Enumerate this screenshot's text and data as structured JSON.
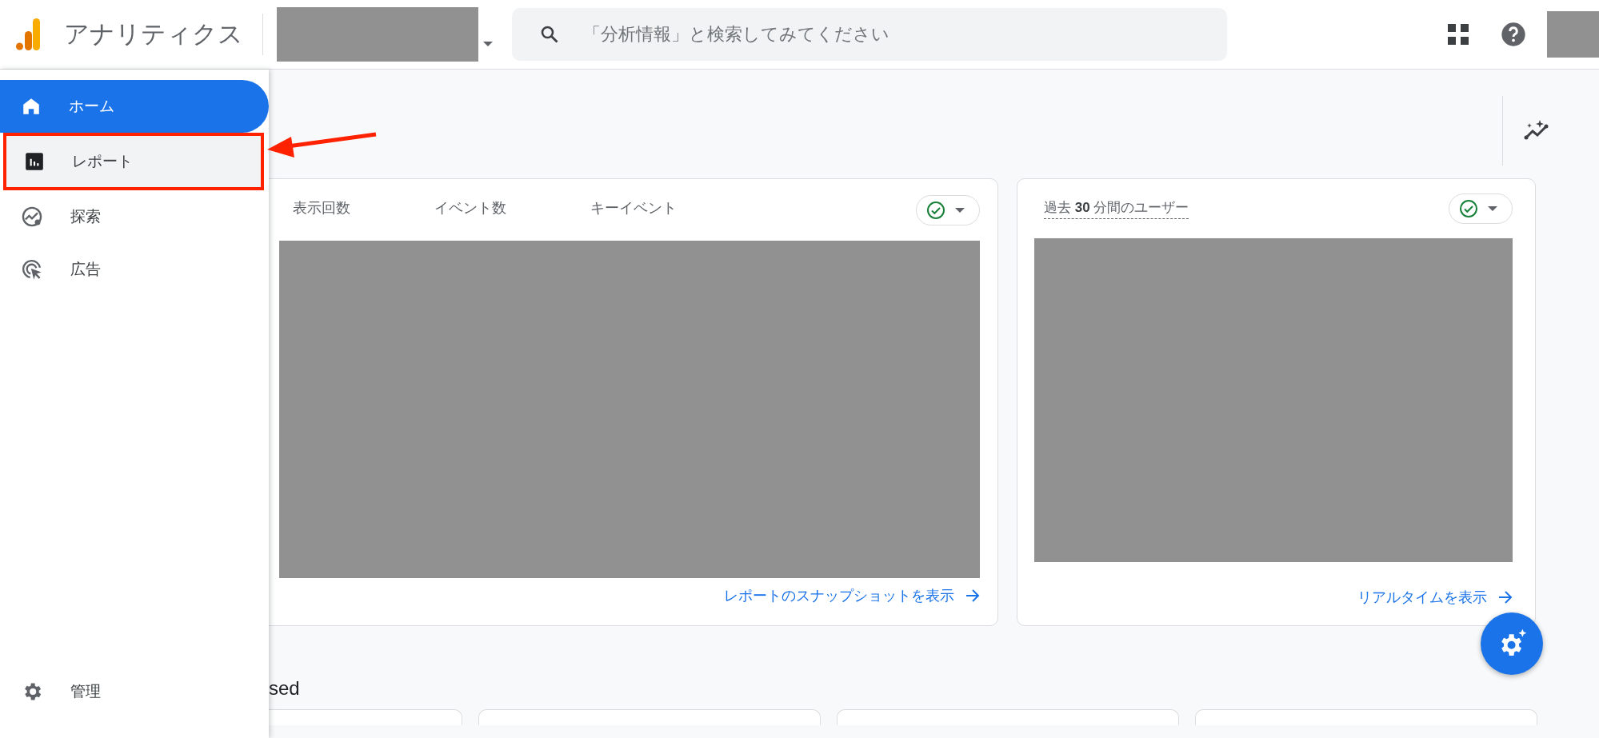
{
  "header": {
    "product_title": "アナリティクス",
    "search": {
      "placeholder": "「分析情報」と検索してみてください"
    }
  },
  "sidebar": {
    "items": [
      {
        "label": "ホーム",
        "kind": "home",
        "selected": true,
        "highlighted": false
      },
      {
        "label": "レポート",
        "kind": "reports",
        "selected": false,
        "highlighted": true
      },
      {
        "label": "探索",
        "kind": "explore",
        "selected": false,
        "highlighted": false
      },
      {
        "label": "広告",
        "kind": "ads",
        "selected": false,
        "highlighted": false
      }
    ],
    "footer_item": {
      "label": "管理",
      "kind": "settings"
    }
  },
  "summary_card": {
    "metrics": [
      "表示回数",
      "イベント数",
      "キーイベント"
    ],
    "link": "レポートのスナップショットを表示"
  },
  "realtime_card": {
    "title": "過去 **30** 分間のユーザー",
    "link": "リアルタイムを表示"
  },
  "section_heading": "sed",
  "bottom_cards": [
    {
      "kind": "card"
    },
    {
      "kind": "card"
    },
    {
      "kind": "card"
    },
    {
      "kind": "card"
    }
  ]
}
